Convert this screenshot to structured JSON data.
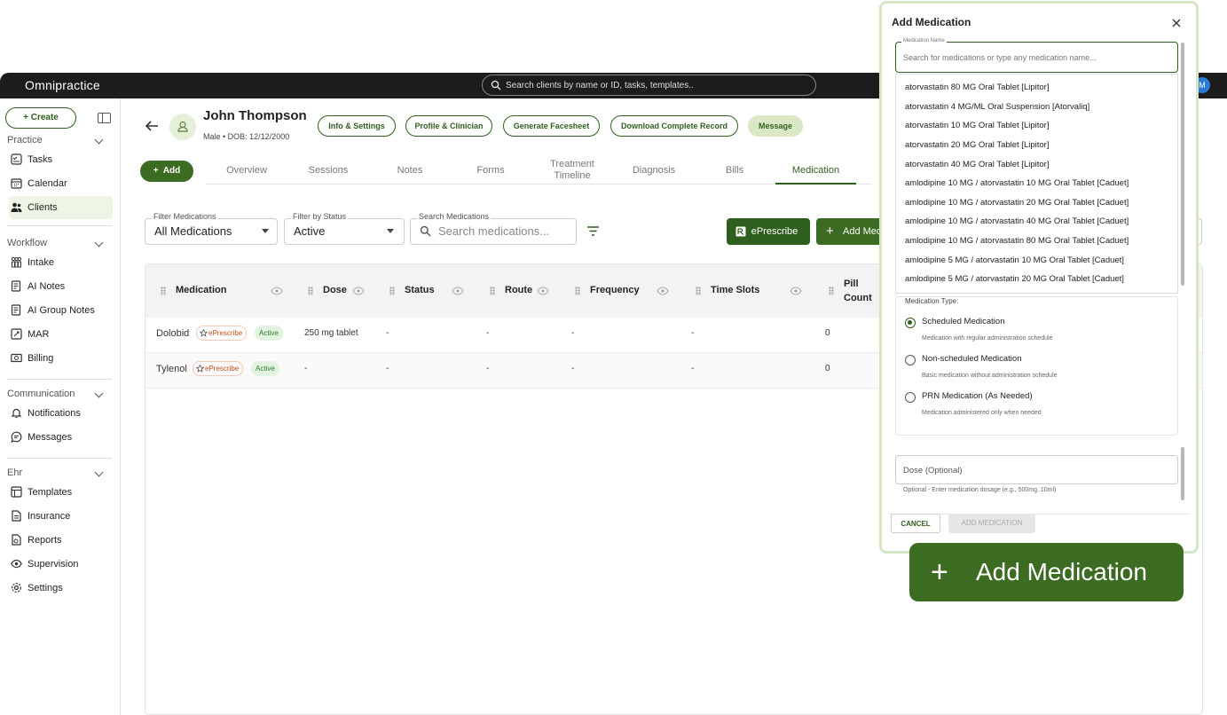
{
  "app": {
    "logo": "Omnipractice",
    "search_placeholder": "Search clients by name or ID, tasks, templates..",
    "avatar_initial": "M"
  },
  "sidebar": {
    "create_label": "Create",
    "sections": [
      {
        "title": "Practice",
        "items": [
          "Tasks",
          "Calendar",
          "Clients"
        ]
      },
      {
        "title": "Workflow",
        "items": [
          "Intake",
          "AI Notes",
          "AI Group Notes",
          "MAR",
          "Billing"
        ]
      },
      {
        "title": "Communication",
        "items": [
          "Notifications",
          "Messages"
        ]
      },
      {
        "title": "Ehr",
        "items": [
          "Templates",
          "Insurance",
          "Reports",
          "Supervision",
          "Settings"
        ]
      }
    ],
    "active_item": "Clients"
  },
  "patient": {
    "name": "John Thompson",
    "meta": "Male • DOB: 12/12/2000",
    "actions": [
      "Info & Settings",
      "Profile & Clinician",
      "Generate Facesheet",
      "Download Complete Record",
      "Message"
    ]
  },
  "add_button": "Add",
  "tabs": [
    "Overview",
    "Sessions",
    "Notes",
    "Forms",
    "Treatment Timeline",
    "Diagnosis",
    "Bills",
    "Medication"
  ],
  "active_tab": "Medication",
  "filters": {
    "filter_medications": {
      "label": "Filter Medications",
      "value": "All Medications"
    },
    "filter_status": {
      "label": "Filter by Status",
      "value": "Active"
    },
    "search": {
      "label": "Search Medications",
      "placeholder": "Search medications..."
    }
  },
  "eprescribe_button": "ePrescribe",
  "add_medication_button": "Add Medication",
  "table": {
    "columns": [
      "Medication",
      "Dose",
      "Status",
      "Route",
      "Frequency",
      "Time Slots",
      "Pill Count"
    ],
    "rows": [
      {
        "name": "Dolobid",
        "erx": "ePrescribe",
        "status": "Active",
        "dose": "250 mg tablet",
        "status_col": "-",
        "route": "-",
        "frequency": "-",
        "time_slots": "-",
        "pill_count": "0"
      },
      {
        "name": "Tylenol",
        "erx": "ePrescribe",
        "status": "Active",
        "dose": "-",
        "status_col": "-",
        "route": "-",
        "frequency": "-",
        "time_slots": "-",
        "pill_count": "0"
      }
    ]
  },
  "modal": {
    "title": "Add Medication",
    "input_label": "Medication Name",
    "input_placeholder": "Search for medications or type any medication name...",
    "options": [
      "atorvastatin 80 MG Oral Tablet [Lipitor]",
      "atorvastatin 4 MG/ML Oral Suspension [Atorvaliq]",
      "atorvastatin 10 MG Oral Tablet [Lipitor]",
      "atorvastatin 20 MG Oral Tablet [Lipitor]",
      "atorvastatin 40 MG Oral Tablet [Lipitor]",
      "amlodipine 10 MG / atorvastatin 10 MG Oral Tablet [Caduet]",
      "amlodipine 10 MG / atorvastatin 20 MG Oral Tablet [Caduet]",
      "amlodipine 10 MG / atorvastatin 40 MG Oral Tablet [Caduet]",
      "amlodipine 10 MG / atorvastatin 80 MG Oral Tablet [Caduet]",
      "amlodipine 5 MG / atorvastatin 10 MG Oral Tablet [Caduet]",
      "amlodipine 5 MG / atorvastatin 20 MG Oral Tablet [Caduet]"
    ],
    "type_label": "Medication Type:",
    "types": [
      {
        "label": "Scheduled Medication",
        "desc": "Medication with regular administration schedule",
        "selected": true
      },
      {
        "label": "Non-scheduled Medication",
        "desc": "Basic medication without administration schedule",
        "selected": false
      },
      {
        "label": "PRN Medication (As Needed)",
        "desc": "Medication administered only when needed",
        "selected": false
      }
    ],
    "dose_placeholder": "Dose (Optional)",
    "dose_hint": "Optional - Enter medication dosage (e.g., 500mg, 10ml)",
    "cancel": "CANCEL",
    "submit": "ADD MEDICATION"
  },
  "callout": {
    "label": "Add Medication"
  },
  "colors": {
    "brand": "#3c6b22",
    "dark_brand": "#2f5f1f",
    "topbar": "#1c1c1c",
    "erx_tag": "#c94f1d",
    "active_tag": "#2b7a35"
  }
}
